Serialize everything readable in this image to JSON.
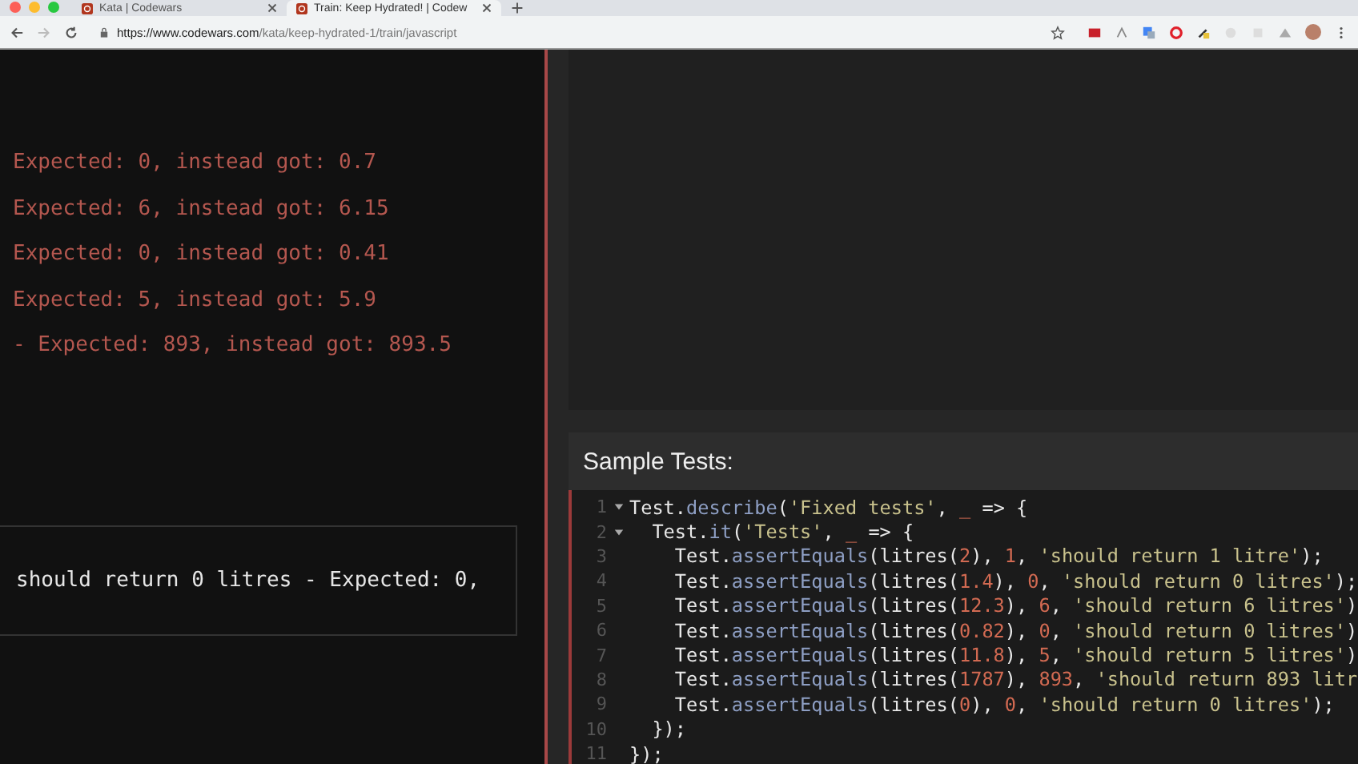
{
  "browser": {
    "tabs": [
      {
        "label": "Kata | Codewars",
        "selected": false
      },
      {
        "label": "Train: Keep Hydrated! | Codew",
        "selected": true
      }
    ],
    "url_host": "https://www.codewars.com",
    "url_path": "/kata/keep-hydrated-1/train/javascript"
  },
  "output": {
    "lines": [
      "Expected: 0, instead got: 0.7",
      "Expected: 6, instead got: 6.15",
      "Expected: 0, instead got: 0.41",
      "Expected: 5, instead got: 5.9",
      "- Expected: 893, instead got: 893.5"
    ],
    "result_text": "should return 0 litres - Expected: 0,"
  },
  "sample_tests": {
    "title": "Sample Tests:",
    "lines": [
      {
        "number": "1",
        "fold": true,
        "tokens": [
          {
            "kind": "plain",
            "text": "Test."
          },
          {
            "kind": "method",
            "text": "describe"
          },
          {
            "kind": "plain",
            "text": "("
          },
          {
            "kind": "string",
            "text": "'Fixed tests'"
          },
          {
            "kind": "plain",
            "text": ", "
          },
          {
            "kind": "number",
            "text": "_"
          },
          {
            "kind": "plain",
            "text": " => {"
          }
        ]
      },
      {
        "number": "2",
        "fold": true,
        "tokens": [
          {
            "kind": "plain",
            "text": "  Test."
          },
          {
            "kind": "method",
            "text": "it"
          },
          {
            "kind": "plain",
            "text": "("
          },
          {
            "kind": "string",
            "text": "'Tests'"
          },
          {
            "kind": "plain",
            "text": ", "
          },
          {
            "kind": "number",
            "text": "_"
          },
          {
            "kind": "plain",
            "text": " => {"
          }
        ]
      },
      {
        "number": "3",
        "fold": false,
        "tokens": [
          {
            "kind": "plain",
            "text": "    Test."
          },
          {
            "kind": "method",
            "text": "assertEquals"
          },
          {
            "kind": "plain",
            "text": "(litres("
          },
          {
            "kind": "number",
            "text": "2"
          },
          {
            "kind": "plain",
            "text": "), "
          },
          {
            "kind": "number",
            "text": "1"
          },
          {
            "kind": "plain",
            "text": ", "
          },
          {
            "kind": "string",
            "text": "'should return 1 litre'"
          },
          {
            "kind": "plain",
            "text": ");"
          }
        ]
      },
      {
        "number": "4",
        "fold": false,
        "tokens": [
          {
            "kind": "plain",
            "text": "    Test."
          },
          {
            "kind": "method",
            "text": "assertEquals"
          },
          {
            "kind": "plain",
            "text": "(litres("
          },
          {
            "kind": "number",
            "text": "1.4"
          },
          {
            "kind": "plain",
            "text": "), "
          },
          {
            "kind": "number",
            "text": "0"
          },
          {
            "kind": "plain",
            "text": ", "
          },
          {
            "kind": "string",
            "text": "'should return 0 litres'"
          },
          {
            "kind": "plain",
            "text": ");"
          }
        ]
      },
      {
        "number": "5",
        "fold": false,
        "tokens": [
          {
            "kind": "plain",
            "text": "    Test."
          },
          {
            "kind": "method",
            "text": "assertEquals"
          },
          {
            "kind": "plain",
            "text": "(litres("
          },
          {
            "kind": "number",
            "text": "12.3"
          },
          {
            "kind": "plain",
            "text": "), "
          },
          {
            "kind": "number",
            "text": "6"
          },
          {
            "kind": "plain",
            "text": ", "
          },
          {
            "kind": "string",
            "text": "'should return 6 litres'"
          },
          {
            "kind": "plain",
            "text": ")"
          }
        ]
      },
      {
        "number": "6",
        "fold": false,
        "tokens": [
          {
            "kind": "plain",
            "text": "    Test."
          },
          {
            "kind": "method",
            "text": "assertEquals"
          },
          {
            "kind": "plain",
            "text": "(litres("
          },
          {
            "kind": "number",
            "text": "0.82"
          },
          {
            "kind": "plain",
            "text": "), "
          },
          {
            "kind": "number",
            "text": "0"
          },
          {
            "kind": "plain",
            "text": ", "
          },
          {
            "kind": "string",
            "text": "'should return 0 litres'"
          },
          {
            "kind": "plain",
            "text": ")"
          }
        ]
      },
      {
        "number": "7",
        "fold": false,
        "tokens": [
          {
            "kind": "plain",
            "text": "    Test."
          },
          {
            "kind": "method",
            "text": "assertEquals"
          },
          {
            "kind": "plain",
            "text": "(litres("
          },
          {
            "kind": "number",
            "text": "11.8"
          },
          {
            "kind": "plain",
            "text": "), "
          },
          {
            "kind": "number",
            "text": "5"
          },
          {
            "kind": "plain",
            "text": ", "
          },
          {
            "kind": "string",
            "text": "'should return 5 litres'"
          },
          {
            "kind": "plain",
            "text": ")"
          }
        ]
      },
      {
        "number": "8",
        "fold": false,
        "tokens": [
          {
            "kind": "plain",
            "text": "    Test."
          },
          {
            "kind": "method",
            "text": "assertEquals"
          },
          {
            "kind": "plain",
            "text": "(litres("
          },
          {
            "kind": "number",
            "text": "1787"
          },
          {
            "kind": "plain",
            "text": "), "
          },
          {
            "kind": "number",
            "text": "893"
          },
          {
            "kind": "plain",
            "text": ", "
          },
          {
            "kind": "string",
            "text": "'should return 893 litr"
          }
        ]
      },
      {
        "number": "9",
        "fold": false,
        "tokens": [
          {
            "kind": "plain",
            "text": "    Test."
          },
          {
            "kind": "method",
            "text": "assertEquals"
          },
          {
            "kind": "plain",
            "text": "(litres("
          },
          {
            "kind": "number",
            "text": "0"
          },
          {
            "kind": "plain",
            "text": "), "
          },
          {
            "kind": "number",
            "text": "0"
          },
          {
            "kind": "plain",
            "text": ", "
          },
          {
            "kind": "string",
            "text": "'should return 0 litres'"
          },
          {
            "kind": "plain",
            "text": ");"
          }
        ]
      },
      {
        "number": "10",
        "fold": false,
        "tokens": [
          {
            "kind": "plain",
            "text": "  });"
          }
        ]
      },
      {
        "number": "11",
        "fold": false,
        "tokens": [
          {
            "kind": "plain",
            "text": "});"
          }
        ]
      }
    ]
  }
}
